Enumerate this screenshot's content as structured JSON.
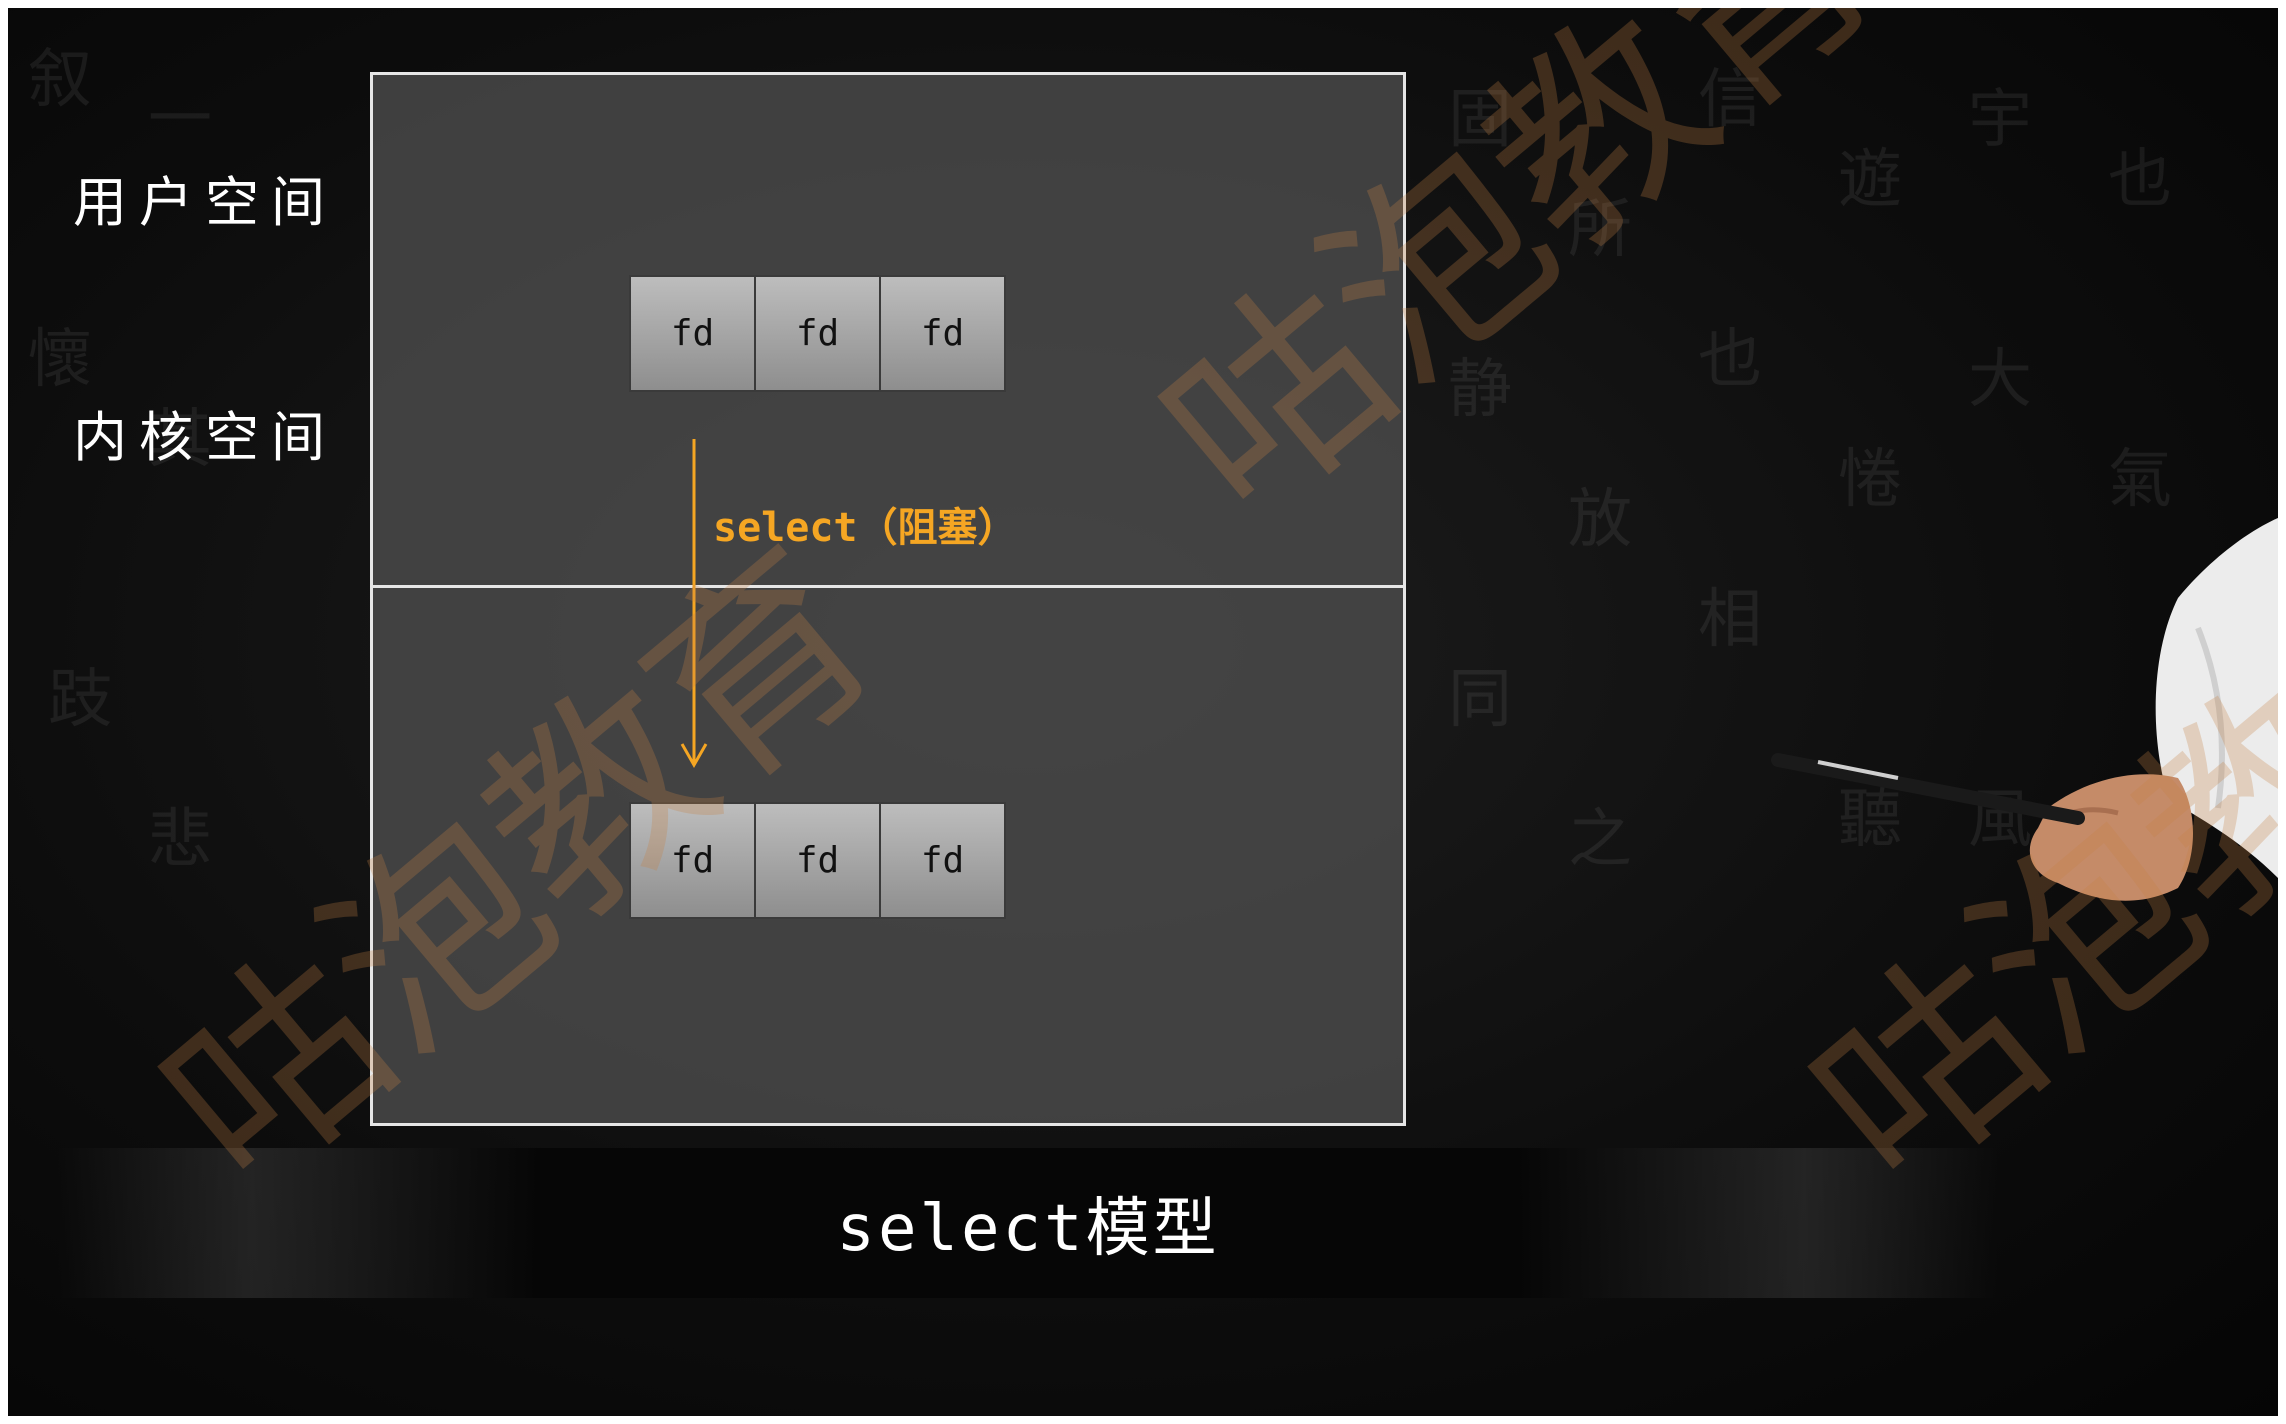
{
  "labels": {
    "user_space": "用户空间",
    "kernel_space": "内核空间"
  },
  "diagram": {
    "user_fds": [
      "fd",
      "fd",
      "fd"
    ],
    "kernel_fds": [
      "fd",
      "fd",
      "fd"
    ],
    "call_label": "select（阻塞）"
  },
  "title": "select模型",
  "watermark_text": "咕泡教育",
  "colors": {
    "background": "#0d0d0d",
    "panel": "#4e4e4e",
    "border": "#e6e6e6",
    "fd_box": "#a8a8a8",
    "arrow": "#f5a623",
    "text": "#ffffff",
    "watermark": "#c48046"
  }
}
